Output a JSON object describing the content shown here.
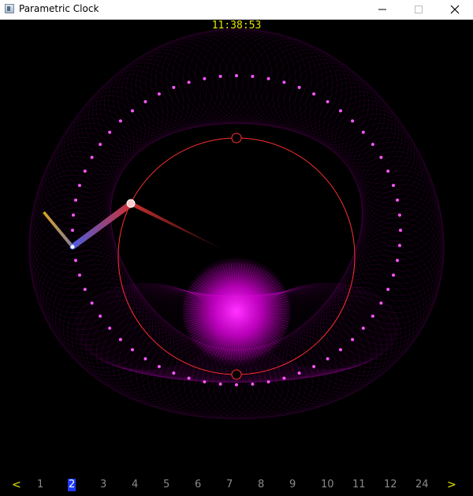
{
  "window": {
    "title": "Parametric Clock",
    "minimize_icon": "minimize-icon",
    "maximize_icon": "maximize-icon",
    "close_icon": "close-icon"
  },
  "clock": {
    "time": "11:38:53",
    "time_color": "#e6e600",
    "pattern_color": "#ff00ff",
    "circle_color": "#ff3030"
  },
  "nav": {
    "prev_label": "<",
    "next_label": ">",
    "items": [
      "1",
      "2",
      "3",
      "4",
      "5",
      "6",
      "7",
      "8",
      "9",
      "10",
      "11",
      "12",
      "24"
    ],
    "selected": "2",
    "selected_color": "#1f38ff",
    "arrow_color": "#e6e600"
  }
}
